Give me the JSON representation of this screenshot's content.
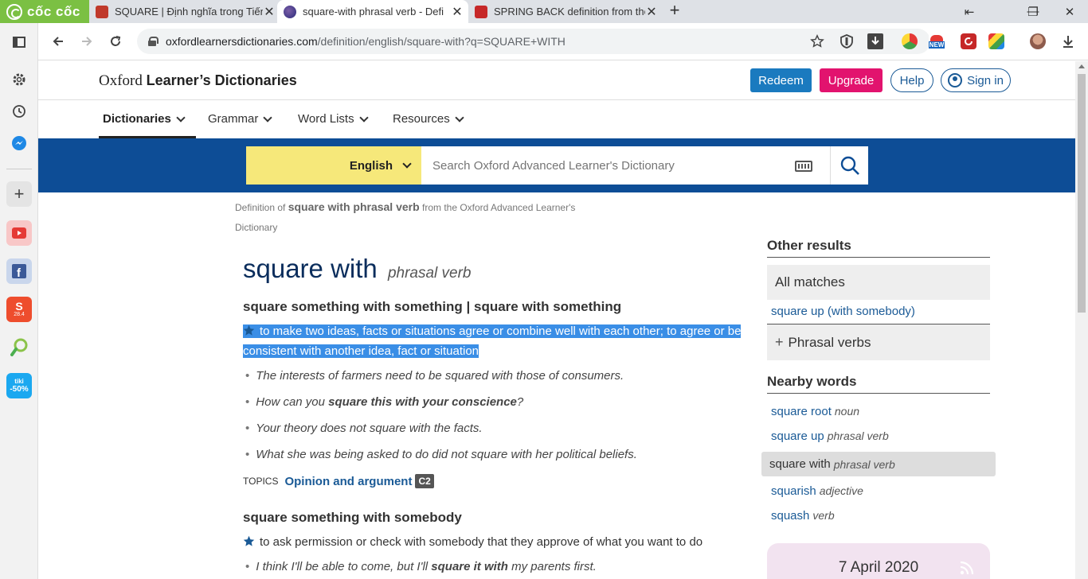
{
  "browser": {
    "brand": "cốc cốc",
    "tabs": [
      {
        "title": "SQUARE | Định nghĩa trong Tiếng",
        "active": false
      },
      {
        "title": "square-with phrasal verb - Defi",
        "active": true
      },
      {
        "title": "SPRING BACK definition from the",
        "active": false
      }
    ],
    "url_domain": "oxfordlearnersdictionaries.com",
    "url_path": "/definition/english/square-with?q=SQUARE+WITH",
    "ext_new_badge": "NEW",
    "sidebar_badges": {
      "shopee_date": "28.4",
      "tiki": "tiki",
      "tiki_discount": "-50%"
    }
  },
  "site": {
    "logo_regular": "Oxford ",
    "logo_bold": "Learner’s Dictionaries",
    "redeem": "Redeem",
    "upgrade": "Upgrade",
    "help": "Help",
    "signin": "Sign in",
    "nav": [
      "Dictionaries",
      "Grammar",
      "Word Lists",
      "Resources"
    ],
    "language": "English",
    "search_placeholder": "Search Oxford Advanced Learner's Dictionary"
  },
  "entry": {
    "def_of_prefix": "Definition of ",
    "def_of_bold": "square with phrasal verb",
    "def_of_suffix": " from the Oxford Advanced Learner's Dictionary",
    "headword": "square with",
    "pos": "phrasal verb",
    "sense1": {
      "head": "square something with something | square with something",
      "definition": "to make two ideas, facts or situations agree or combine well with each other; to agree or be consistent with another idea, fact or situation",
      "examples": [
        {
          "pre": "The interests of farmers need to be squared with those of consumers.",
          "bold": "",
          "post": ""
        },
        {
          "pre": "How can you ",
          "bold": "square this with your conscience",
          "post": "?"
        },
        {
          "pre": "Your theory does not square with the facts.",
          "bold": "",
          "post": ""
        },
        {
          "pre": "What she was being asked to do did not square with her political beliefs.",
          "bold": "",
          "post": ""
        }
      ],
      "topics_label": "TOPICS",
      "topic": "Opinion and argument",
      "level": "C2"
    },
    "sense2": {
      "head": "square something with somebody",
      "definition": "to ask permission or check with somebody that they approve of what you want to do",
      "example_pre": "I think I'll be able to come, but I'll ",
      "example_bold": "square it with",
      "example_post": " my parents first."
    }
  },
  "sidebar_right": {
    "other_results": "Other results",
    "all_matches": "All matches",
    "square_up_link": "square up (with somebody)",
    "phrasal_verbs": "Phrasal verbs",
    "nearby_words": "Nearby words",
    "nearby": [
      {
        "word": "square root",
        "pos": "noun"
      },
      {
        "word": "square up",
        "pos": "phrasal verb"
      },
      {
        "word": "square with",
        "pos": "phrasal verb"
      },
      {
        "word": "squarish",
        "pos": "adjective"
      },
      {
        "word": "squash",
        "pos": "verb"
      }
    ],
    "wotd_date": "7 April 2020"
  },
  "colors": {
    "oxford_blue": "#0d4d96",
    "language_yellow": "#f6e87a",
    "upgrade_pink": "#e2136e",
    "redeem_blue": "#1a7abf",
    "coccoc_green": "#7bc043",
    "highlight": "#3a8ee6"
  }
}
